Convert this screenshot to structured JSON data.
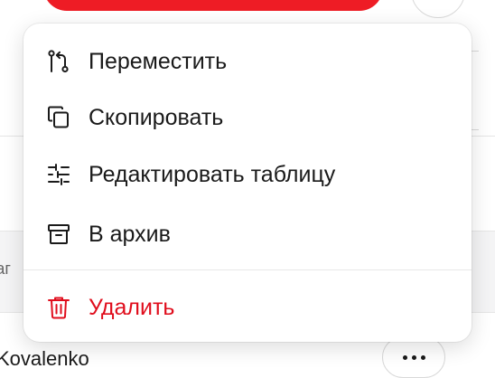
{
  "background": {
    "header_fragment": "ваг",
    "row_name": "Kovalenko"
  },
  "menu": {
    "items": [
      {
        "label": "Переместить",
        "icon": "move-branch-icon"
      },
      {
        "label": "Скопировать",
        "icon": "copy-icon"
      },
      {
        "label": "Редактировать таблицу",
        "icon": "sliders-icon"
      },
      {
        "label": "В архив",
        "icon": "archive-icon"
      }
    ],
    "danger_item": {
      "label": "Удалить",
      "icon": "trash-icon"
    }
  },
  "colors": {
    "accent_red": "#ee1c25",
    "danger_text": "#e00d1c",
    "text": "#1a1a1a"
  }
}
